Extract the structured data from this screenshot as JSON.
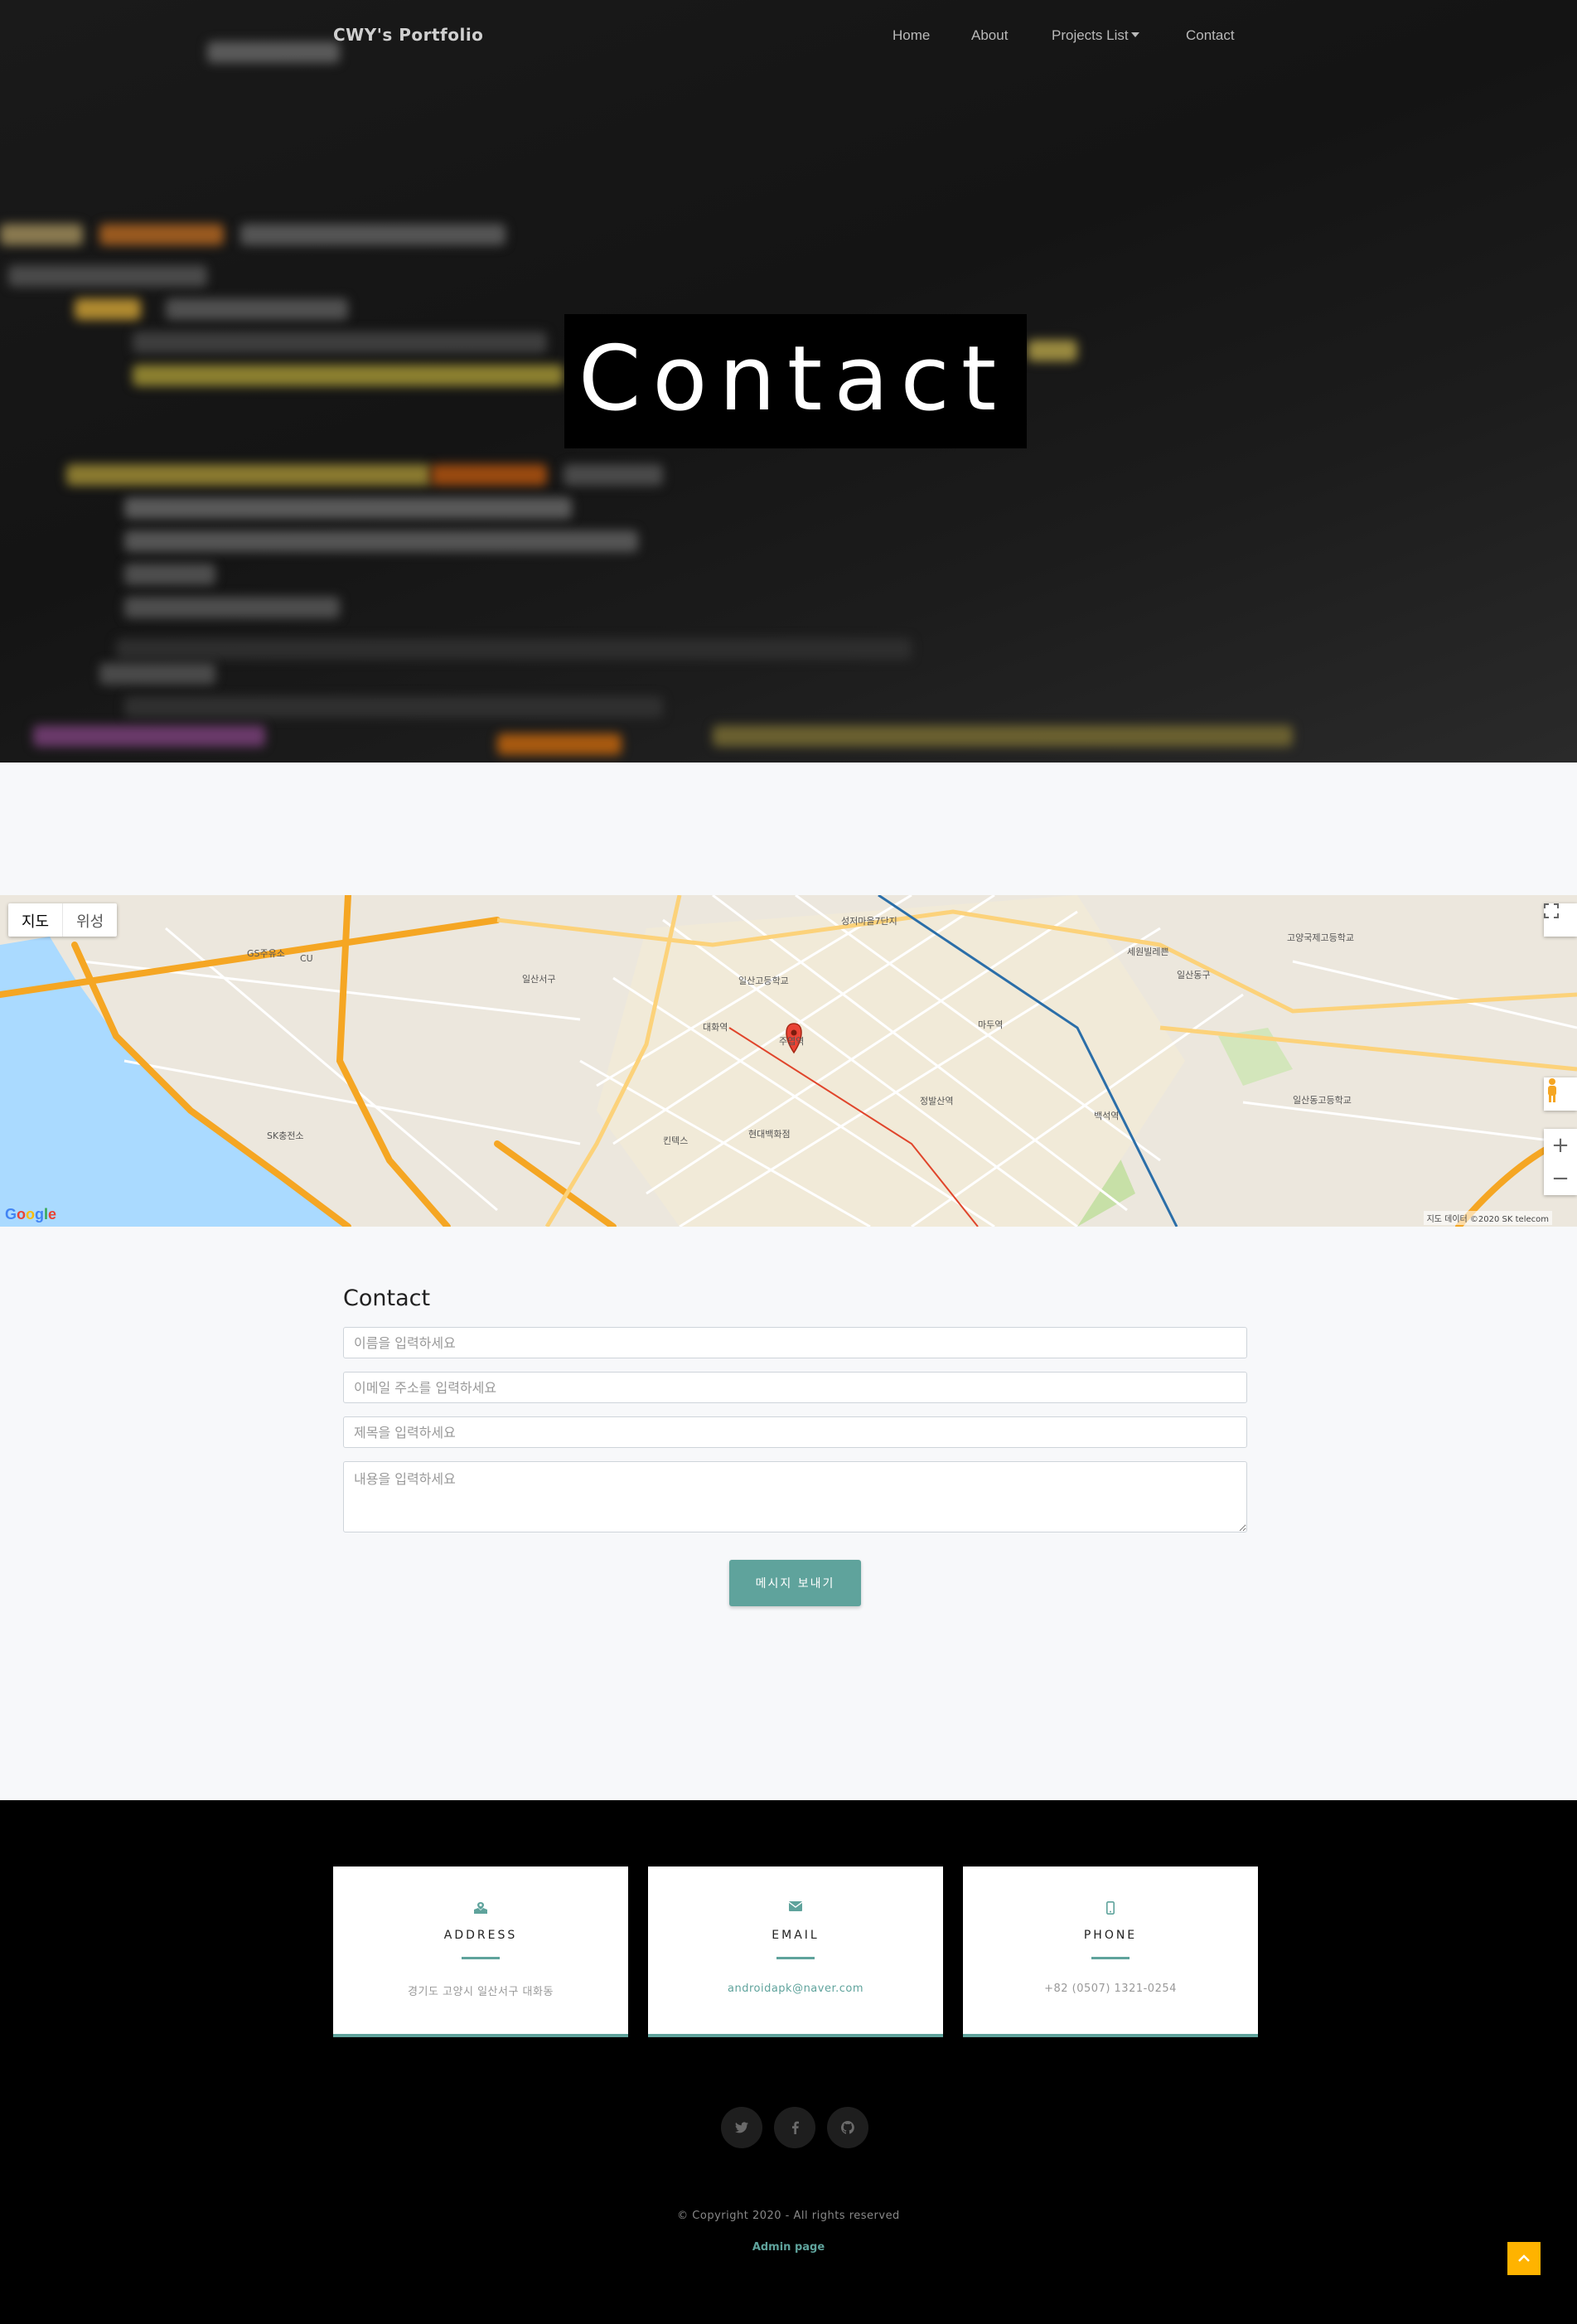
{
  "navbar": {
    "brand": "CWY's Portfolio",
    "items": [
      {
        "label": "Home"
      },
      {
        "label": "About"
      },
      {
        "label": "Projects List"
      },
      {
        "label": "Contact"
      }
    ]
  },
  "hero": {
    "title": "Contact"
  },
  "map": {
    "type_buttons": [
      "지도",
      "위성"
    ],
    "google_logo": "Google",
    "attribution": "지도 데이터 ©2020 SK telecom",
    "place_labels": [
      "일산서구",
      "일산동구",
      "대화역",
      "주엽역",
      "정발산역",
      "마두역",
      "백석역",
      "세원빌레쁜",
      "성저마을7단지",
      "일산고등학교",
      "고양국제고등학교",
      "일산동고등학교",
      "킨텍스",
      "현대백화점",
      "SK충전소",
      "GS주유소",
      "CU"
    ],
    "colors": {
      "water": "#aadaff",
      "road": "#f5a623",
      "park": "#c7e0a7",
      "land": "#ece7dd",
      "marker": "#ea4335"
    }
  },
  "form": {
    "title": "Contact",
    "name_placeholder": "이름을 입력하세요",
    "email_placeholder": "이메일 주소를 입력하세요",
    "subject_placeholder": "제목을 입력하세요",
    "message_placeholder": "내용을 입력하세요",
    "submit_label": "메시지 보내기"
  },
  "footer": {
    "cards": [
      {
        "label": "ADDRESS",
        "value": "경기도 고양시 일산서구 대화동",
        "icon": "map-icon"
      },
      {
        "label": "EMAIL",
        "value": "androidapk@naver.com",
        "icon": "envelope-icon"
      },
      {
        "label": "PHONE",
        "value": "+82 (0507) 1321-0254",
        "icon": "mobile-icon"
      }
    ],
    "social": [
      "twitter-icon",
      "facebook-icon",
      "github-icon"
    ],
    "copyright": "© Copyright 2020 - All rights reserved",
    "admin_link": "Admin page"
  },
  "colors": {
    "accent": "#5fa39c",
    "footer_bg": "#000000",
    "page_bg": "#f7f8fa",
    "scroll_top": "#ffb300"
  }
}
